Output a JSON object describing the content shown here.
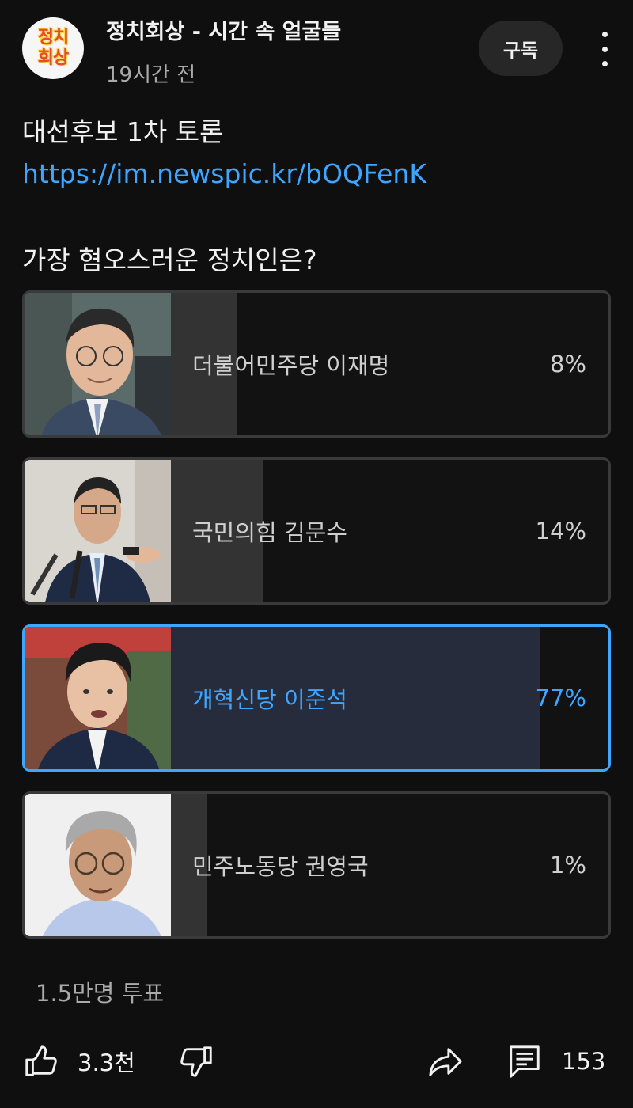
{
  "header": {
    "logo_line1": "정치",
    "logo_line2": "회상",
    "channel_name": "정치회상 - 시간 속 얼굴들",
    "time": "19시간 전",
    "subscribe_label": "구독"
  },
  "post": {
    "text": "대선후보 1차 토론",
    "link": "https://im.newspic.kr/bOQFenK"
  },
  "poll": {
    "question": "가장 혐오스러운 정치인은?",
    "options": [
      {
        "label": "더불어민주당 이재명",
        "percent": "8%",
        "value": 8,
        "selected": false
      },
      {
        "label": "국민의힘 김문수",
        "percent": "14%",
        "value": 14,
        "selected": false
      },
      {
        "label": "개혁신당 이준석",
        "percent": "77%",
        "value": 77,
        "selected": true
      },
      {
        "label": "민주노동당 권영국",
        "percent": "1%",
        "value": 1,
        "selected": false
      }
    ],
    "votes": "1.5만명 투표"
  },
  "footer": {
    "like_count": "3.3천",
    "comment_count": "153"
  },
  "colors": {
    "background": "#0f0f0f",
    "accent": "#3ea6ff",
    "selected_fill": "#262c3c",
    "unselected_fill": "#333333"
  },
  "icons": [
    "like-icon",
    "dislike-icon",
    "share-icon",
    "comment-icon",
    "more-vert-icon"
  ]
}
